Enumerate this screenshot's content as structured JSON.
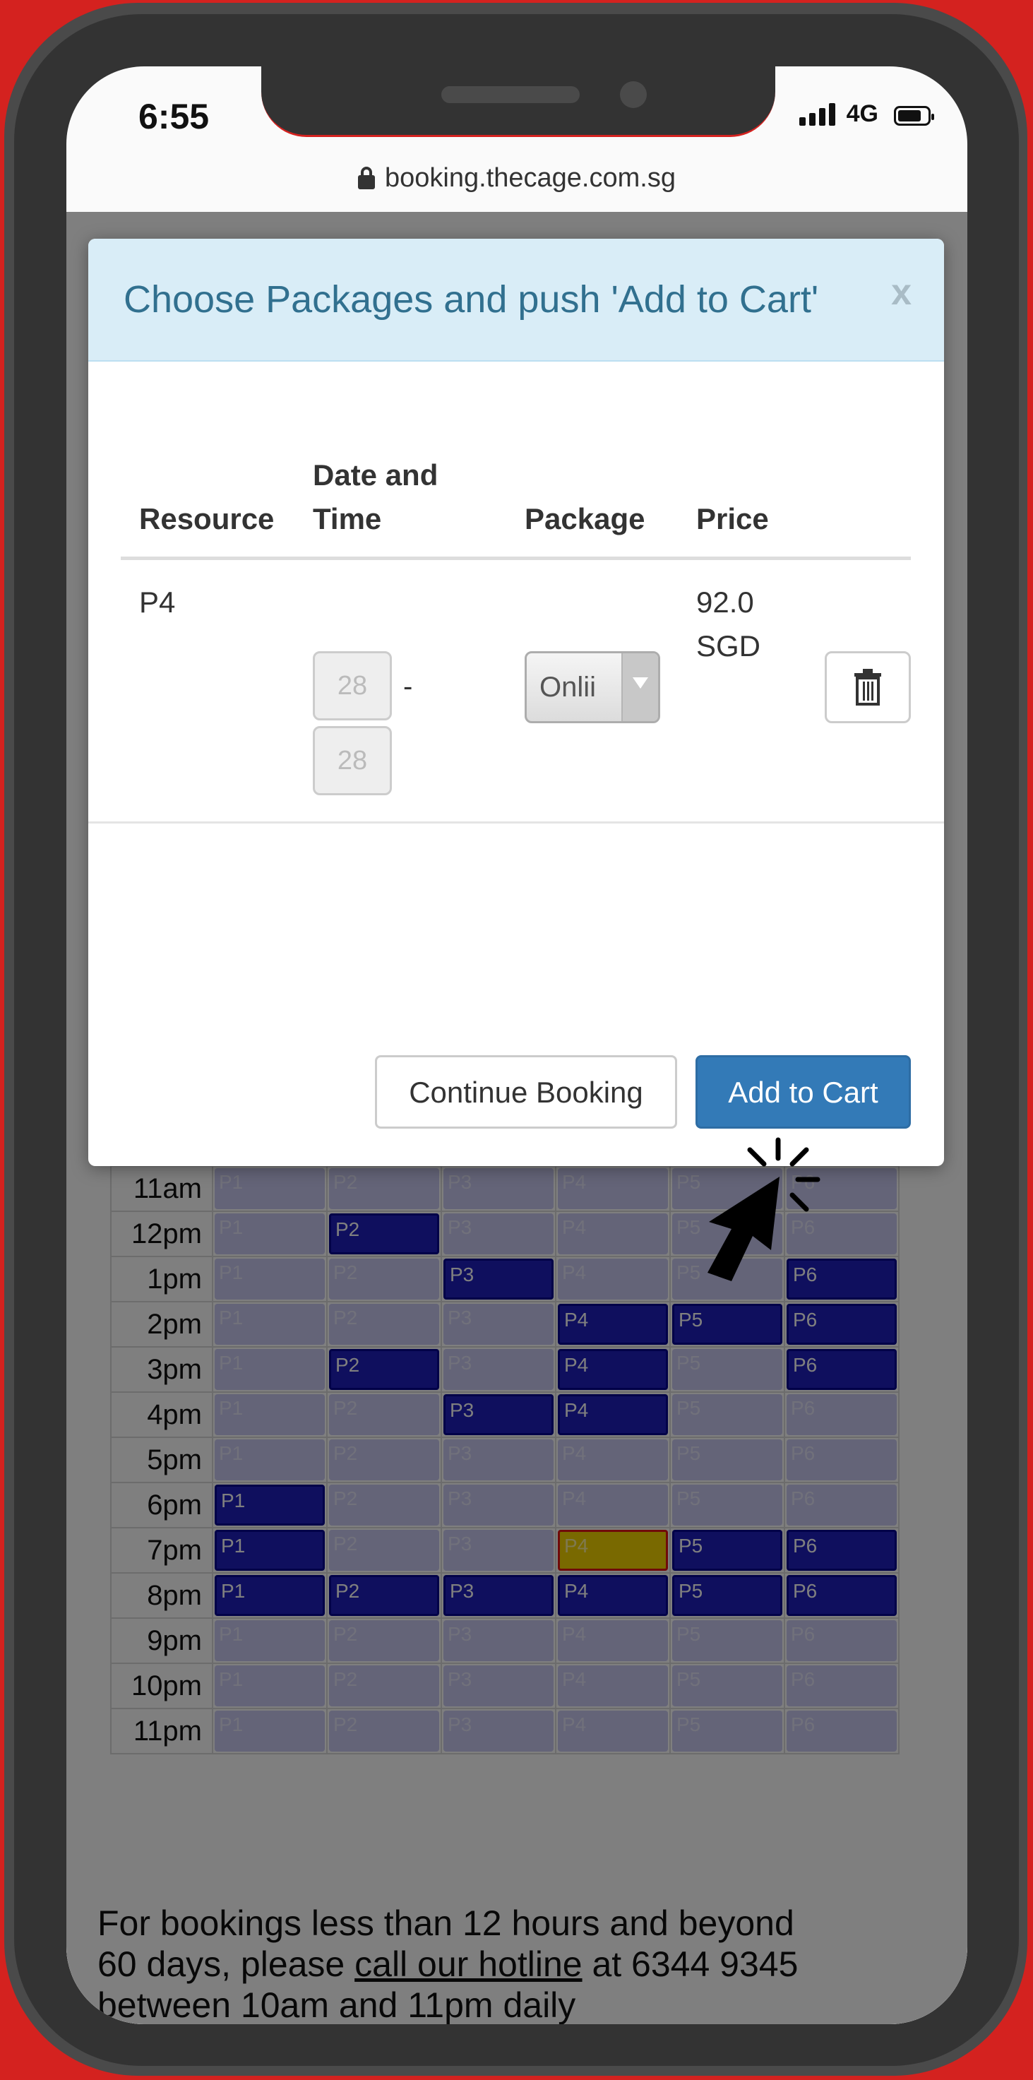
{
  "status_bar": {
    "time": "6:55",
    "network": "4G"
  },
  "browser": {
    "url": "booking.thecage.com.sg"
  },
  "modal": {
    "title": "Choose Packages and push 'Add to Cart'",
    "close_label": "x",
    "columns": {
      "resource": "Resource",
      "date_time_1": "Date and",
      "date_time_2": "Time",
      "package": "Package",
      "price": "Price"
    },
    "row": {
      "resource": "P4",
      "start_value": "28",
      "end_value": "28",
      "dash": "-",
      "package_value": "Onlii",
      "price_1": "92.0",
      "price_2": "SGD"
    },
    "buttons": {
      "continue": "Continue Booking",
      "add_to_cart": "Add to Cart"
    }
  },
  "schedule": {
    "rows": [
      {
        "time": "11am",
        "cells": [
          [
            "P1",
            "a"
          ],
          [
            "P2",
            "a"
          ],
          [
            "P3",
            "a"
          ],
          [
            "P4",
            "a"
          ],
          [
            "P5",
            "a"
          ],
          [
            "P6",
            "a"
          ]
        ]
      },
      {
        "time": "12pm",
        "cells": [
          [
            "P1",
            "a"
          ],
          [
            "P2",
            "b"
          ],
          [
            "P3",
            "a"
          ],
          [
            "P4",
            "a"
          ],
          [
            "P5",
            "a"
          ],
          [
            "P6",
            "a"
          ]
        ]
      },
      {
        "time": "1pm",
        "cells": [
          [
            "P1",
            "a"
          ],
          [
            "P2",
            "a"
          ],
          [
            "P3",
            "b"
          ],
          [
            "P4",
            "a"
          ],
          [
            "P5",
            "a"
          ],
          [
            "P6",
            "b"
          ]
        ]
      },
      {
        "time": "2pm",
        "cells": [
          [
            "P1",
            "a"
          ],
          [
            "P2",
            "a"
          ],
          [
            "P3",
            "a"
          ],
          [
            "P4",
            "b"
          ],
          [
            "P5",
            "b"
          ],
          [
            "P6",
            "b"
          ]
        ]
      },
      {
        "time": "3pm",
        "cells": [
          [
            "P1",
            "a"
          ],
          [
            "P2",
            "b"
          ],
          [
            "P3",
            "a"
          ],
          [
            "P4",
            "b"
          ],
          [
            "P5",
            "a"
          ],
          [
            "P6",
            "b"
          ]
        ]
      },
      {
        "time": "4pm",
        "cells": [
          [
            "P1",
            "a"
          ],
          [
            "P2",
            "a"
          ],
          [
            "P3",
            "b"
          ],
          [
            "P4",
            "b"
          ],
          [
            "P5",
            "a"
          ],
          [
            "P6",
            "a"
          ]
        ]
      },
      {
        "time": "5pm",
        "cells": [
          [
            "P1",
            "a"
          ],
          [
            "P2",
            "a"
          ],
          [
            "P3",
            "a"
          ],
          [
            "P4",
            "a"
          ],
          [
            "P5",
            "a"
          ],
          [
            "P6",
            "a"
          ]
        ]
      },
      {
        "time": "6pm",
        "cells": [
          [
            "P1",
            "b"
          ],
          [
            "P2",
            "a"
          ],
          [
            "P3",
            "a"
          ],
          [
            "P4",
            "a"
          ],
          [
            "P5",
            "a"
          ],
          [
            "P6",
            "a"
          ]
        ]
      },
      {
        "time": "7pm",
        "cells": [
          [
            "P1",
            "b"
          ],
          [
            "P2",
            "a"
          ],
          [
            "P3",
            "a"
          ],
          [
            "P4",
            "s"
          ],
          [
            "P5",
            "b"
          ],
          [
            "P6",
            "b"
          ]
        ]
      },
      {
        "time": "8pm",
        "cells": [
          [
            "P1",
            "b"
          ],
          [
            "P2",
            "b"
          ],
          [
            "P3",
            "b"
          ],
          [
            "P4",
            "b"
          ],
          [
            "P5",
            "b"
          ],
          [
            "P6",
            "b"
          ]
        ]
      },
      {
        "time": "9pm",
        "cells": [
          [
            "P1",
            "a"
          ],
          [
            "P2",
            "a"
          ],
          [
            "P3",
            "a"
          ],
          [
            "P4",
            "a"
          ],
          [
            "P5",
            "a"
          ],
          [
            "P6",
            "a"
          ]
        ]
      },
      {
        "time": "10pm",
        "cells": [
          [
            "P1",
            "a"
          ],
          [
            "P2",
            "a"
          ],
          [
            "P3",
            "a"
          ],
          [
            "P4",
            "a"
          ],
          [
            "P5",
            "a"
          ],
          [
            "P6",
            "a"
          ]
        ]
      },
      {
        "time": "11pm",
        "cells": [
          [
            "P1",
            "a"
          ],
          [
            "P2",
            "a"
          ],
          [
            "P3",
            "a"
          ],
          [
            "P4",
            "a"
          ],
          [
            "P5",
            "a"
          ],
          [
            "P6",
            "a"
          ]
        ]
      }
    ]
  },
  "notice": {
    "line1": "For bookings less than 12 hours and beyond",
    "line2a": "60 days, please ",
    "hotline": "call our hotline",
    "line2b": " at 6344 9345",
    "line3": "between 10am and 11pm daily"
  },
  "colors": {
    "booked": "#1f1fbd",
    "available": "#c8c8f0",
    "selected": "#f3d200",
    "primary": "#337ab7",
    "header_bg": "#d9edf7"
  }
}
